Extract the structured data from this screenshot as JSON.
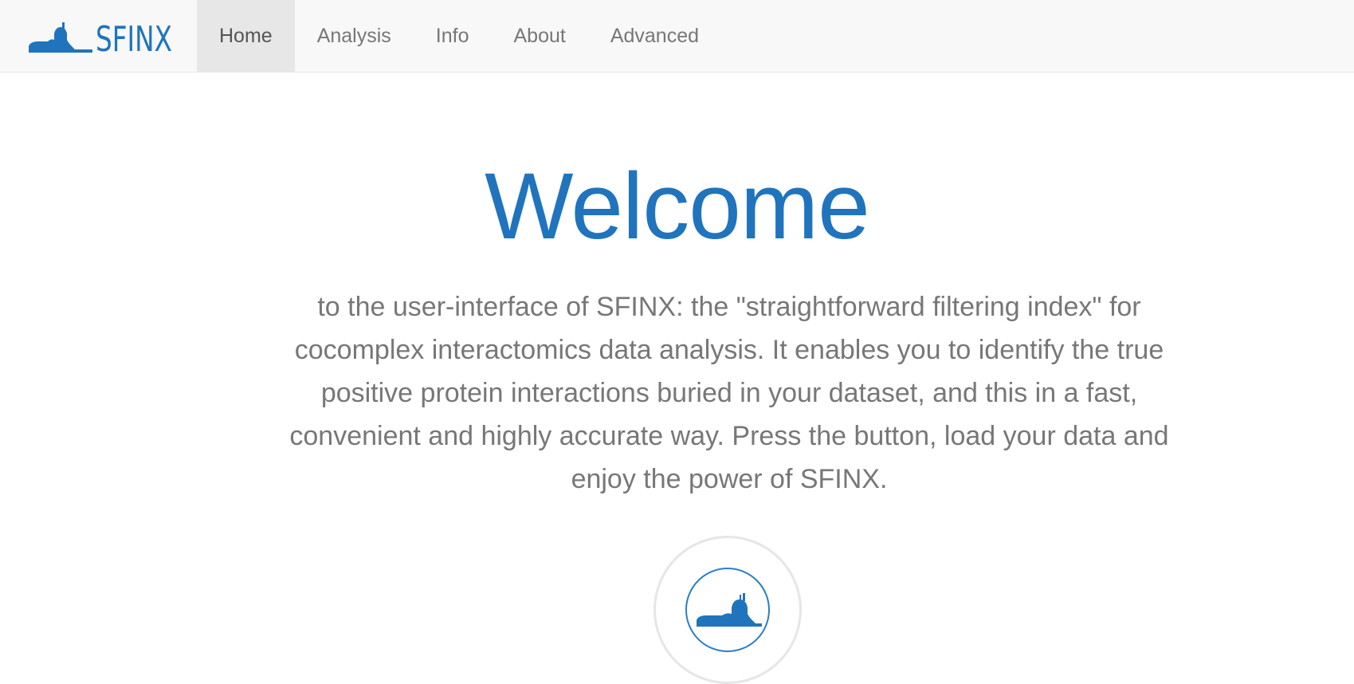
{
  "brand": {
    "logo_text": "SFINX",
    "accent_color": "#2074bd"
  },
  "nav": {
    "items": [
      {
        "label": "Home",
        "active": true
      },
      {
        "label": "Analysis",
        "active": false
      },
      {
        "label": "Info",
        "active": false
      },
      {
        "label": "About",
        "active": false
      },
      {
        "label": "Advanced",
        "active": false
      }
    ]
  },
  "hero": {
    "title": "Welcome",
    "intro": "to the user-interface of SFINX: the \"straightforward filtering index\" for cocomplex interactomics data analysis. It enables you to identify the true positive protein interactions buried in your dataset, and this in a fast, convenient and highly accurate way. Press the button, load your data and enjoy the power of SFINX.",
    "start_button_icon": "sphinx-icon"
  }
}
